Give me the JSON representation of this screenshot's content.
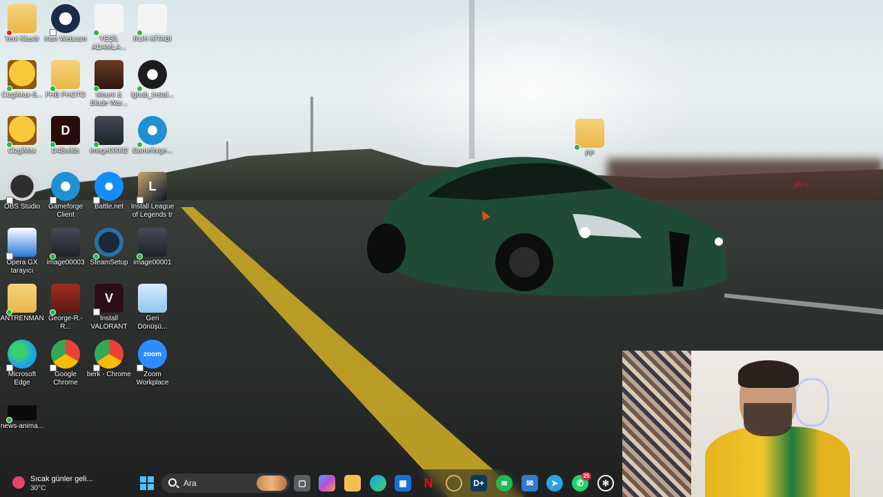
{
  "desktop": {
    "icons": [
      {
        "label": "Yeni Klasör",
        "icon": "folder-icon",
        "status": "error"
      },
      {
        "label": "Iriun Webcam",
        "icon": "webcam-icon",
        "status": "shortcut"
      },
      {
        "label": "YEŞİL ADAMLA...",
        "icon": "document-icon",
        "status": "ok"
      },
      {
        "label": "RUH KİTABI",
        "icon": "document-icon",
        "status": "ok"
      },
      {
        "label": "CizgiMax-S...",
        "icon": "cartoon-icon",
        "status": "ok"
      },
      {
        "label": "FHB PHOTO",
        "icon": "folder-icon",
        "status": "ok"
      },
      {
        "label": "Mount & Blade War...",
        "icon": "horse-icon",
        "status": "ok"
      },
      {
        "label": "lghub_instal...",
        "icon": "logitech-icon",
        "status": "ok"
      },
      {
        "label": "CizgiMax",
        "icon": "cartoon-icon",
        "status": "ok"
      },
      {
        "label": "D4Builds",
        "icon": "d4-icon",
        "status": "ok"
      },
      {
        "label": "image00002",
        "icon": "image-icon",
        "status": "ok"
      },
      {
        "label": "Gameforge...",
        "icon": "gameforge-icon",
        "status": "ok"
      },
      {
        "label": "OBS Studio",
        "icon": "obs-icon",
        "status": "shortcut"
      },
      {
        "label": "Gameforge Client",
        "icon": "gameforge-icon",
        "status": "shortcut"
      },
      {
        "label": "Battle.net",
        "icon": "battlenet-icon",
        "status": "shortcut"
      },
      {
        "label": "Install League of Legends tr",
        "icon": "league-icon",
        "status": "shortcut"
      },
      {
        "label": "Opera GX tarayıcı",
        "icon": "opera-gx-icon",
        "status": "shortcut"
      },
      {
        "label": "image00003",
        "icon": "image-icon",
        "status": "ok"
      },
      {
        "label": "SteamSetup",
        "icon": "steam-icon",
        "status": "ok"
      },
      {
        "label": "image00001",
        "icon": "image-icon",
        "status": "ok"
      },
      {
        "label": "ANTRENMAN",
        "icon": "folder-icon",
        "status": "ok"
      },
      {
        "label": "George-R.-R...",
        "icon": "book-icon",
        "status": "ok"
      },
      {
        "label": "Install VALORANT",
        "icon": "valorant-icon",
        "status": "shortcut"
      },
      {
        "label": "Geri Dönüşü...",
        "icon": "recycle-bin-icon",
        "status": "none"
      },
      {
        "label": "Microsoft Edge",
        "icon": "edge-icon",
        "status": "shortcut"
      },
      {
        "label": "Google Chrome",
        "icon": "chrome-icon",
        "status": "shortcut"
      },
      {
        "label": "berk - Chrome",
        "icon": "chrome-icon",
        "status": "shortcut"
      },
      {
        "label": "Zoom Workplace",
        "icon": "zoom-icon",
        "status": "shortcut"
      },
      {
        "label": "news-anima...",
        "icon": "video-icon",
        "status": "ok"
      }
    ],
    "folder_pp": {
      "label": "PP",
      "icon": "folder-icon",
      "status": "ok"
    },
    "zoom_text": "zoom"
  },
  "taskbar": {
    "weather_title": "Sıcak günler geli...",
    "weather_temp": "30°C",
    "search_placeholder": "Ara",
    "apps": [
      {
        "name": "start-button",
        "icon": "windows-icon"
      },
      {
        "name": "task-view",
        "icon": "task-view-icon"
      },
      {
        "name": "copilot",
        "icon": "copilot-icon"
      },
      {
        "name": "file-explorer",
        "icon": "folder-icon"
      },
      {
        "name": "edge",
        "icon": "edge-icon"
      },
      {
        "name": "microsoft-store",
        "icon": "store-icon"
      },
      {
        "name": "netflix",
        "icon": "netflix-icon"
      },
      {
        "name": "hp-app",
        "icon": "circle-icon"
      },
      {
        "name": "disney-plus",
        "icon": "disney-icon"
      },
      {
        "name": "spotify",
        "icon": "spotify-icon"
      },
      {
        "name": "mail",
        "icon": "mail-icon"
      },
      {
        "name": "telegram",
        "icon": "telegram-icon"
      },
      {
        "name": "whatsapp",
        "icon": "whatsapp-icon",
        "badge": "25"
      },
      {
        "name": "chatgpt",
        "icon": "chatgpt-icon"
      }
    ]
  },
  "colors": {
    "accent": "#4cc2ff",
    "icon_ok": "#2fb34a",
    "icon_error": "#d9262c"
  }
}
